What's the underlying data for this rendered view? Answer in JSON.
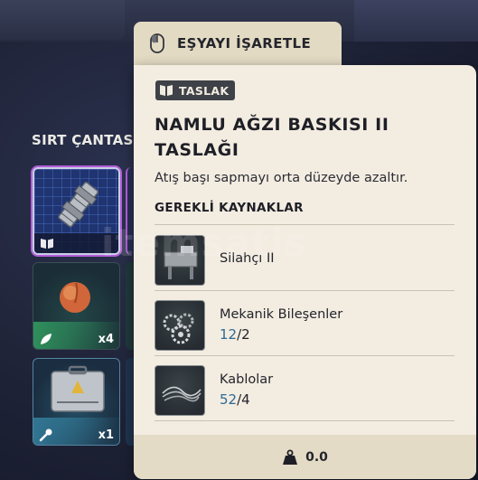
{
  "action_tab": {
    "label": "EŞYAYI İŞARETLE",
    "icon": "mouse-icon"
  },
  "inventory": {
    "title": "SIRT ÇANTASI",
    "slots": [
      {
        "item": "blueprint",
        "rarity_color": "#b25ed8",
        "count": ""
      },
      {
        "item": "peach",
        "rarity_color": "#3ee07a",
        "count": "x4"
      },
      {
        "item": "toolbox",
        "rarity_color": "#46bee6",
        "count": "x1"
      }
    ]
  },
  "tooltip": {
    "badge": "TASLAK",
    "title_line1": "NAMLU AĞZI BASKISI II",
    "title_line2": "TASLAĞI",
    "description": "Atış başı sapmayı orta düzeyde azaltır.",
    "requirements_title": "GEREKLİ KAYNAKLAR",
    "requirements": [
      {
        "name": "Silahçı II",
        "icon": "workbench-icon"
      },
      {
        "name": "Mekanik Bileşenler",
        "have": "12",
        "sep": "/",
        "need": "2",
        "icon": "gears-icon"
      },
      {
        "name": "Kablolar",
        "have": "52",
        "sep": "/",
        "need": "4",
        "icon": "cables-icon"
      }
    ],
    "weight": "0.0"
  },
  "watermark": "itemsatis",
  "colors": {
    "tooltip_bg": "#f3ece1",
    "tab_bg": "#e3dac3",
    "qty_have": "#2d6a95"
  }
}
